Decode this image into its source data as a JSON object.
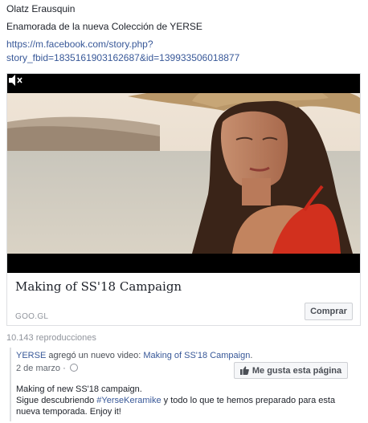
{
  "post": {
    "author": "Olatz Erausquin",
    "text": "Enamorada de la nueva Colección de YERSE",
    "link_line1": "https://m.facebook.com/story.php?",
    "link_line2": "story_fbid=1835161903162687&id=139933506018877"
  },
  "card": {
    "title": "Making of SS'18 Campaign",
    "domain": "GOO.GL",
    "buy_label": "Comprar"
  },
  "video": {
    "mute_icon": "speaker-muted-icon"
  },
  "views": "10.143 reproducciones",
  "shared": {
    "page_name": "YERSE",
    "action": " agregó un nuevo video: ",
    "video_title": "Making of SS'18 Campaign",
    "period": ".",
    "date": "2 de marzo · ",
    "like_label": "Me gusta esta página",
    "body_line1": "Making of new SS'18 campaign.",
    "body_pre": "Sigue descubriendo ",
    "hashtag": "#YerseKeramike",
    "body_post": " y todo lo que te hemos preparado para esta nueva temporada. Enjoy it!"
  },
  "colors": {
    "link": "#385898",
    "muted": "#90949c",
    "border": "#dddfe2"
  }
}
